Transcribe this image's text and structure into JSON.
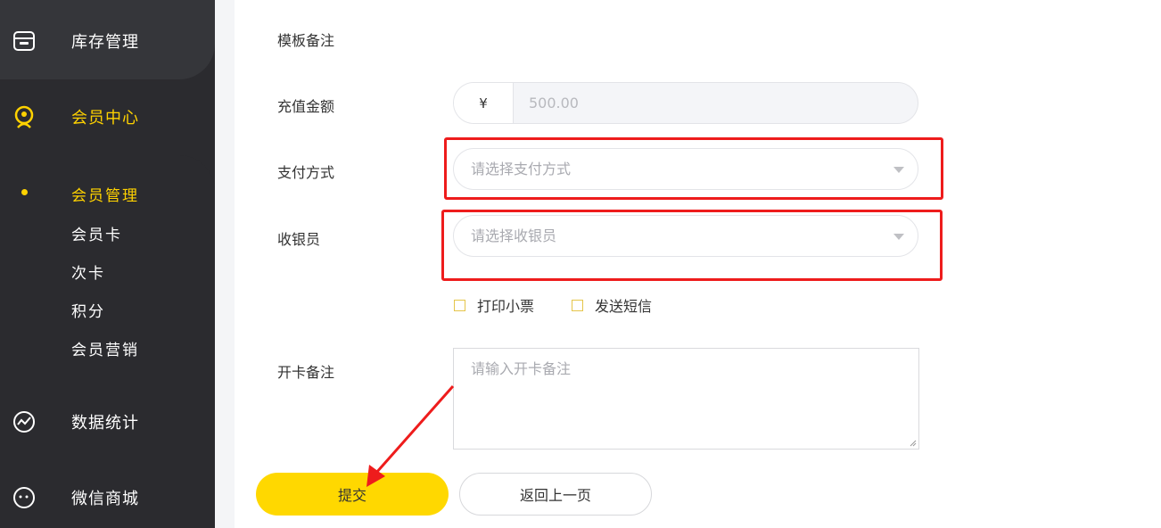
{
  "sidebar": {
    "items": [
      {
        "label": "库存管理",
        "icon": "archive-icon"
      },
      {
        "label": "会员中心",
        "icon": "member-icon",
        "active": true
      },
      {
        "label": "数据统计",
        "icon": "chart-icon"
      },
      {
        "label": "微信商城",
        "icon": "chat-icon"
      }
    ],
    "sub_items": [
      {
        "label": "会员管理",
        "active": true
      },
      {
        "label": "会员卡"
      },
      {
        "label": "次卡"
      },
      {
        "label": "积分"
      },
      {
        "label": "会员营销"
      }
    ],
    "accent_color": "#ffd200"
  },
  "form": {
    "template_note_label": "模板备注",
    "recharge_label": "充值金额",
    "currency_symbol": "¥",
    "recharge_value": "500.00",
    "payment_label": "支付方式",
    "payment_placeholder": "请选择支付方式",
    "cashier_label": "收银员",
    "cashier_placeholder": "请选择收银员",
    "print_receipt_label": "打印小票",
    "send_sms_label": "发送短信",
    "card_note_label": "开卡备注",
    "card_note_placeholder": "请输入开卡备注",
    "submit_label": "提交",
    "back_label": "返回上一页"
  },
  "annotation_color": "#ee1c1c"
}
